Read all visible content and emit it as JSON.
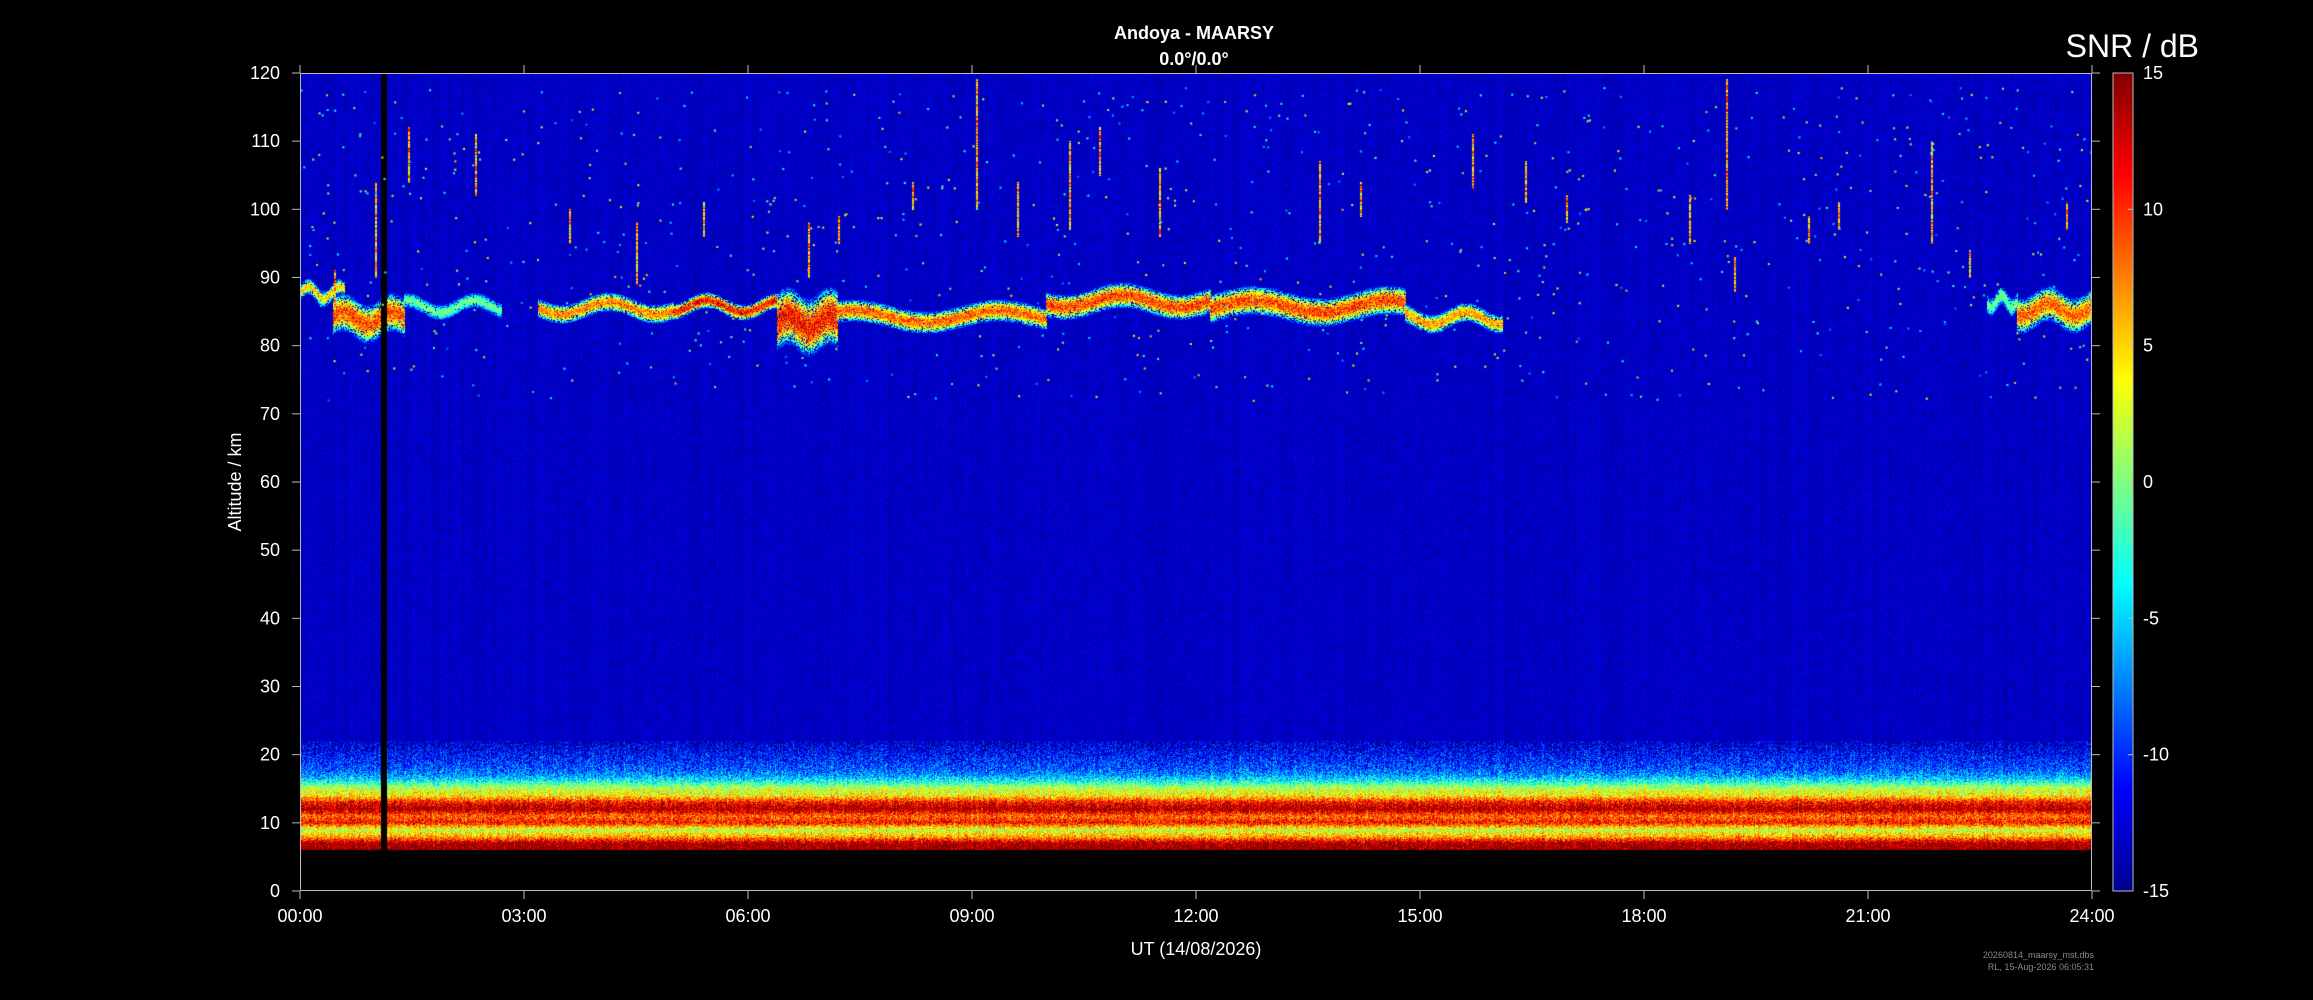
{
  "chart_data": {
    "type": "heatmap",
    "title": "Andoya - MAARSY",
    "subtitle": "0.0°/0.0°",
    "xlabel": "UT (14/08/2026)",
    "ylabel": "Altitude / km",
    "x_tick_labels": [
      "00:00",
      "03:00",
      "06:00",
      "09:00",
      "12:00",
      "15:00",
      "18:00",
      "21:00",
      "24:00"
    ],
    "x_range_hours": [
      0,
      24
    ],
    "ylim": [
      0,
      120
    ],
    "y_ticks": [
      0,
      10,
      20,
      30,
      40,
      50,
      60,
      70,
      80,
      90,
      100,
      110,
      120
    ],
    "colorbar": {
      "title": "SNR / dB",
      "range": [
        -15,
        15
      ],
      "ticks": [
        15,
        10,
        5,
        0,
        -5,
        -10,
        -15
      ],
      "colormap": "jet"
    },
    "background_snr_db": -13,
    "data_gap": {
      "start_hour": 1.08,
      "end_hour": 1.16
    },
    "no_data_below_km": 6,
    "pmse_layer": [
      {
        "start_hour": 0.0,
        "end_hour": 0.6,
        "top_km": 89,
        "bottom_km": 86.5,
        "peak_db": 8
      },
      {
        "start_hour": 0.45,
        "end_hour": 1.4,
        "top_km": 87,
        "bottom_km": 81,
        "peak_db": 13
      },
      {
        "start_hour": 1.4,
        "end_hour": 2.7,
        "top_km": 87,
        "bottom_km": 84.5,
        "peak_db": 2
      },
      {
        "start_hour": 3.2,
        "end_hour": 5.0,
        "top_km": 87,
        "bottom_km": 84,
        "peak_db": 11
      },
      {
        "start_hour": 5.0,
        "end_hour": 6.4,
        "top_km": 87,
        "bottom_km": 84.5,
        "peak_db": 15
      },
      {
        "start_hour": 6.4,
        "end_hour": 7.2,
        "top_km": 88,
        "bottom_km": 79,
        "peak_db": 15
      },
      {
        "start_hour": 7.2,
        "end_hour": 10.0,
        "top_km": 86,
        "bottom_km": 82.5,
        "peak_db": 12
      },
      {
        "start_hour": 10.0,
        "end_hour": 12.2,
        "top_km": 88.5,
        "bottom_km": 84.5,
        "peak_db": 13
      },
      {
        "start_hour": 12.2,
        "end_hour": 14.8,
        "top_km": 88,
        "bottom_km": 83.5,
        "peak_db": 13
      },
      {
        "start_hour": 14.8,
        "end_hour": 16.1,
        "top_km": 85.5,
        "bottom_km": 82.5,
        "peak_db": 10
      },
      {
        "start_hour": 22.6,
        "end_hour": 23.0,
        "top_km": 88,
        "bottom_km": 85,
        "peak_db": 2
      },
      {
        "start_hour": 23.0,
        "end_hour": 24.0,
        "top_km": 88,
        "bottom_km": 82.5,
        "peak_db": 12
      }
    ],
    "tropo_profile": [
      {
        "alt_km": 6,
        "snr_db": 15
      },
      {
        "alt_km": 7,
        "snr_db": 14
      },
      {
        "alt_km": 8,
        "snr_db": 6
      },
      {
        "alt_km": 9,
        "snr_db": 2
      },
      {
        "alt_km": 10,
        "snr_db": 11
      },
      {
        "alt_km": 11,
        "snr_db": 8
      },
      {
        "alt_km": 12,
        "snr_db": 14
      },
      {
        "alt_km": 13,
        "snr_db": 11
      },
      {
        "alt_km": 14,
        "snr_db": 4
      },
      {
        "alt_km": 15,
        "snr_db": 2
      },
      {
        "alt_km": 16,
        "snr_db": -3
      },
      {
        "alt_km": 17,
        "snr_db": -7
      },
      {
        "alt_km": 18,
        "snr_db": -9
      },
      {
        "alt_km": 19,
        "snr_db": -10
      },
      {
        "alt_km": 20,
        "snr_db": -11
      },
      {
        "alt_km": 22,
        "snr_db": -13
      }
    ],
    "meteor_echoes": [
      {
        "hour": 0.45,
        "bottom_km": 85,
        "top_km": 91
      },
      {
        "hour": 1.0,
        "bottom_km": 90,
        "top_km": 104
      },
      {
        "hour": 1.45,
        "bottom_km": 104,
        "top_km": 112
      },
      {
        "hour": 2.35,
        "bottom_km": 102,
        "top_km": 111
      },
      {
        "hour": 3.6,
        "bottom_km": 95,
        "top_km": 100
      },
      {
        "hour": 4.5,
        "bottom_km": 89,
        "top_km": 98
      },
      {
        "hour": 5.4,
        "bottom_km": 96,
        "top_km": 101
      },
      {
        "hour": 6.8,
        "bottom_km": 90,
        "top_km": 98
      },
      {
        "hour": 7.2,
        "bottom_km": 95,
        "top_km": 99
      },
      {
        "hour": 8.2,
        "bottom_km": 100,
        "top_km": 104
      },
      {
        "hour": 9.05,
        "bottom_km": 100,
        "top_km": 119
      },
      {
        "hour": 9.6,
        "bottom_km": 96,
        "top_km": 104
      },
      {
        "hour": 10.3,
        "bottom_km": 97,
        "top_km": 110
      },
      {
        "hour": 10.7,
        "bottom_km": 105,
        "top_km": 112
      },
      {
        "hour": 11.5,
        "bottom_km": 96,
        "top_km": 106
      },
      {
        "hour": 13.65,
        "bottom_km": 95,
        "top_km": 107
      },
      {
        "hour": 14.2,
        "bottom_km": 99,
        "top_km": 104
      },
      {
        "hour": 15.7,
        "bottom_km": 103,
        "top_km": 111
      },
      {
        "hour": 16.4,
        "bottom_km": 101,
        "top_km": 107
      },
      {
        "hour": 16.95,
        "bottom_km": 98,
        "top_km": 102
      },
      {
        "hour": 18.6,
        "bottom_km": 95,
        "top_km": 102
      },
      {
        "hour": 19.1,
        "bottom_km": 100,
        "top_km": 119
      },
      {
        "hour": 19.2,
        "bottom_km": 88,
        "top_km": 93
      },
      {
        "hour": 20.2,
        "bottom_km": 95,
        "top_km": 99
      },
      {
        "hour": 20.6,
        "bottom_km": 97,
        "top_km": 101
      },
      {
        "hour": 21.85,
        "bottom_km": 95,
        "top_km": 110
      },
      {
        "hour": 22.35,
        "bottom_km": 90,
        "top_km": 94
      },
      {
        "hour": 23.65,
        "bottom_km": 97,
        "top_km": 101
      }
    ]
  },
  "footer": {
    "file_name": "20260814_maarsy_mst.dbs",
    "stamp": "RL, 15-Aug-2026 06:05:31"
  }
}
